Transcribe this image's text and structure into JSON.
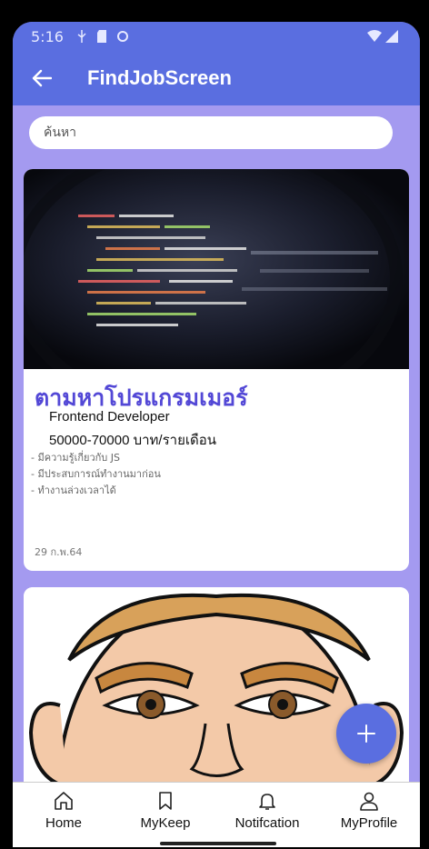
{
  "status_bar": {
    "time": "5:16"
  },
  "app_bar": {
    "title": "FindJobScreen"
  },
  "search": {
    "placeholder": "ค้นหา"
  },
  "jobs": [
    {
      "title": "ตามหาโปรแกรมเมอร์",
      "position": "Frontend Developer",
      "salary": "50000-70000 บาท/รายเดือน",
      "requirements": [
        "- มีความรู้เกี่ยวกับ JS",
        "- มีประสบการณ์ทำงานมาก่อน",
        "- ทำงานล่วงเวลาได้"
      ],
      "date": "29 ก.พ.64"
    }
  ],
  "fab": {
    "icon": "plus-icon"
  },
  "bottom_nav": [
    {
      "label": "Home",
      "icon": "home-icon"
    },
    {
      "label": "MyKeep",
      "icon": "bookmark-icon"
    },
    {
      "label": "Notifcation",
      "icon": "bell-icon"
    },
    {
      "label": "MyProfile",
      "icon": "person-icon"
    }
  ],
  "colors": {
    "primary": "#5a6ee0",
    "background": "#a49af0",
    "title_purple": "#5348d6"
  }
}
